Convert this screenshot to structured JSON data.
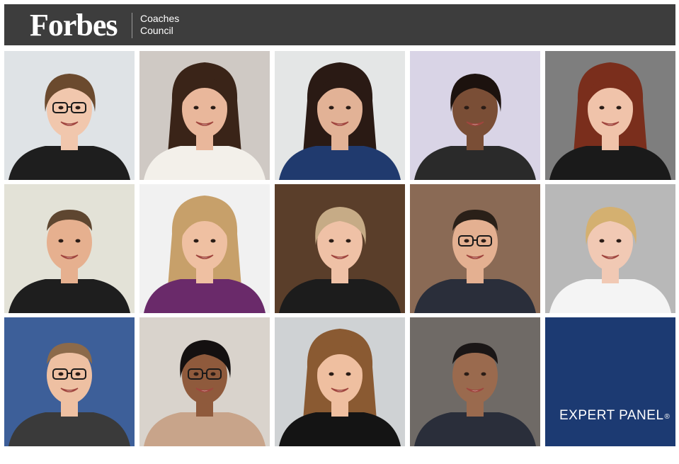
{
  "header": {
    "logo_text": "Forbes",
    "council_line1": "Coaches",
    "council_line2": "Council",
    "background": "#3d3d3d"
  },
  "panel": {
    "label": "EXPERT PANEL",
    "registered": "®",
    "background": "#1c3a72"
  },
  "portraits": [
    {
      "bg": "#dfe3e6",
      "skin": "#f1c7ad",
      "hair": "#6b4a2e",
      "shirt": "#1e1e1e",
      "glasses": true,
      "hair_style": "short"
    },
    {
      "bg": "#cfc9c4",
      "skin": "#e9b79b",
      "hair": "#3a2418",
      "shirt": "#f3f0ea",
      "glasses": false,
      "hair_style": "long"
    },
    {
      "bg": "#e4e6e6",
      "skin": "#e2b296",
      "hair": "#2a1a14",
      "shirt": "#203a6e",
      "glasses": false,
      "hair_style": "long"
    },
    {
      "bg": "#d9d4e6",
      "skin": "#7a4e36",
      "hair": "#1c120e",
      "shirt": "#2a2a2a",
      "glasses": false,
      "hair_style": "short"
    },
    {
      "bg": "#7e7e7e",
      "skin": "#f0c3aa",
      "hair": "#7a2e1c",
      "shirt": "#1a1a1a",
      "glasses": false,
      "hair_style": "long"
    },
    {
      "bg": "#e3e2d7",
      "skin": "#e6b08f",
      "hair": "#5e4630",
      "shirt": "#1e1e1e",
      "glasses": false,
      "hair_style": "man"
    },
    {
      "bg": "#f1f1f1",
      "skin": "#efc0a2",
      "hair": "#c7a06a",
      "shirt": "#6a2a6a",
      "glasses": false,
      "hair_style": "long"
    },
    {
      "bg": "#5a3e2a",
      "skin": "#efc1a6",
      "hair": "#c6ab86",
      "shirt": "#1c1c1c",
      "glasses": false,
      "hair_style": "short"
    },
    {
      "bg": "#8a6a55",
      "skin": "#e4b091",
      "hair": "#2a2018",
      "shirt": "#2a2e3a",
      "glasses": true,
      "hair_style": "man"
    },
    {
      "bg": "#b8b8b8",
      "skin": "#f1c9b4",
      "hair": "#d4b070",
      "shirt": "#f4f4f4",
      "glasses": false,
      "hair_style": "short"
    },
    {
      "bg": "#3d5f99",
      "skin": "#eec0a2",
      "hair": "#8c6a4a",
      "shirt": "#3a3a3a",
      "glasses": true,
      "hair_style": "man"
    },
    {
      "bg": "#d9d3cc",
      "skin": "#8f5a3c",
      "hair": "#141010",
      "shirt": "#c8a48a",
      "glasses": true,
      "hair_style": "short"
    },
    {
      "bg": "#cfd2d4",
      "skin": "#efbfa0",
      "hair": "#8a5a32",
      "shirt": "#141414",
      "glasses": false,
      "hair_style": "long"
    },
    {
      "bg": "#6f6a66",
      "skin": "#9a6a4e",
      "hair": "#1a1616",
      "shirt": "#2a2e3a",
      "glasses": false,
      "hair_style": "man"
    }
  ]
}
